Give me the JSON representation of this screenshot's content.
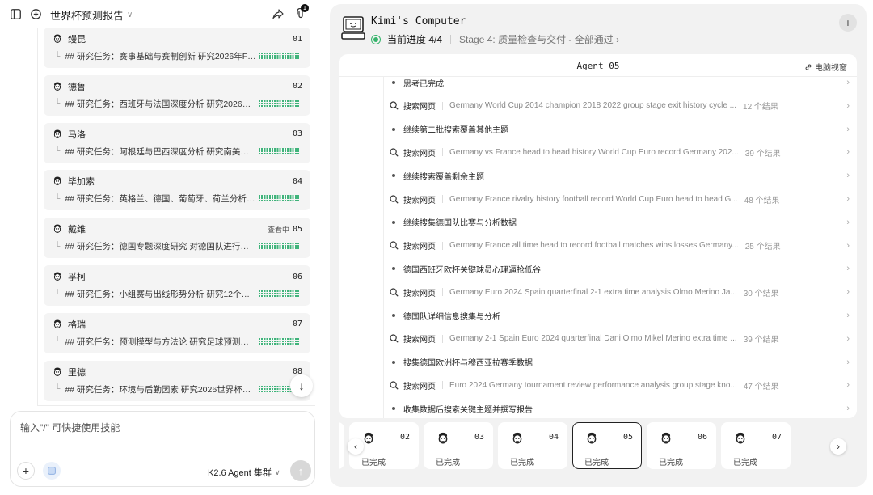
{
  "topbar": {
    "title": "世界杯预测报告",
    "attach_badge": "1"
  },
  "tasks": [
    {
      "name": "缦昆",
      "num": "01",
      "desc": "## 研究任务：赛事基础与赛制创新 研究2026年FIF...",
      "viewing": ""
    },
    {
      "name": "德鲁",
      "num": "02",
      "desc": "## 研究任务：西班牙与法国深度分析 研究2026世...",
      "viewing": ""
    },
    {
      "name": "马洛",
      "num": "03",
      "desc": "## 研究任务：阿根廷与巴西深度分析 研究南美双雄...",
      "viewing": ""
    },
    {
      "name": "毕加索",
      "num": "04",
      "desc": "## 研究任务：英格兰、德国、葡萄牙、荷兰分析 研...",
      "viewing": ""
    },
    {
      "name": "戴维",
      "num": "05",
      "desc": "## 研究任务：德国专题深度研究 对德国队进行超深...",
      "viewing": "查看中"
    },
    {
      "name": "孚柯",
      "num": "06",
      "desc": "## 研究任务：小组赛与出线形势分析 研究12个小组...",
      "viewing": ""
    },
    {
      "name": "格瑞",
      "num": "07",
      "desc": "## 研究任务：预测模型与方法论 研究足球预测的统...",
      "viewing": ""
    },
    {
      "name": "里德",
      "num": "08",
      "desc": "## 研究任务：环境与后勤因素 研究2026世界杯的...",
      "viewing": ""
    }
  ],
  "composer": {
    "placeholder": "输入\"/\" 可快捷使用技能",
    "model": "K2.6 Agent 集群"
  },
  "computer": {
    "title": "Kimi's Computer",
    "progress": "当前进度 4/4",
    "stage": "Stage 4: 质量检查与交付 - 全部通过",
    "os_title": "Agent 05",
    "os_link": "电脑视窗"
  },
  "log": [
    {
      "type": "step",
      "label": "思考已完成"
    },
    {
      "type": "search",
      "label": "搜索网页",
      "query": "Germany World Cup 2014 champion 2018 2022 group stage exit history cycle ...",
      "count": "12 个结果"
    },
    {
      "type": "step",
      "label": "继续第二批搜索覆盖其他主题"
    },
    {
      "type": "search",
      "label": "搜索网页",
      "query": "Germany vs France head to head history World Cup Euro record Germany 202...",
      "count": "39 个结果"
    },
    {
      "type": "step",
      "label": "继续搜索覆盖剩余主题"
    },
    {
      "type": "search",
      "label": "搜索网页",
      "query": "Germany France rivalry history football record World Cup Euro head to head G...",
      "count": "48 个结果"
    },
    {
      "type": "step",
      "label": "继续搜集德国队比赛与分析数据"
    },
    {
      "type": "search",
      "label": "搜索网页",
      "query": "Germany France all time head to record football matches wins losses Germany...",
      "count": "25 个结果"
    },
    {
      "type": "step",
      "label": "德国西班牙欧杯关键球员心理逼抢低谷"
    },
    {
      "type": "search",
      "label": "搜索网页",
      "query": "Germany Euro 2024 Spain quarterfinal 2-1 extra time analysis Olmo Merino Ja...",
      "count": "30 个结果"
    },
    {
      "type": "step",
      "label": "德国队详细信息搜集与分析"
    },
    {
      "type": "search",
      "label": "搜索网页",
      "query": "Germany 2-1 Spain Euro 2024 quarterfinal Dani Olmo Mikel Merino extra time ...",
      "count": "39 个结果"
    },
    {
      "type": "step",
      "label": "搜集德国欧洲杯与穆西亚拉赛季数据"
    },
    {
      "type": "search",
      "label": "搜索网页",
      "query": "Euro 2024 Germany tournament review performance analysis group stage kno...",
      "count": "47 个结果"
    },
    {
      "type": "step",
      "label": "收集数据后搜索关键主题并撰写报告"
    }
  ],
  "agents": [
    {
      "num": "01",
      "status": "已完成"
    },
    {
      "num": "02",
      "status": "已完成"
    },
    {
      "num": "03",
      "status": "已完成"
    },
    {
      "num": "04",
      "status": "已完成"
    },
    {
      "num": "05",
      "status": "已完成"
    },
    {
      "num": "06",
      "status": "已完成"
    },
    {
      "num": "07",
      "status": "已完成"
    }
  ]
}
